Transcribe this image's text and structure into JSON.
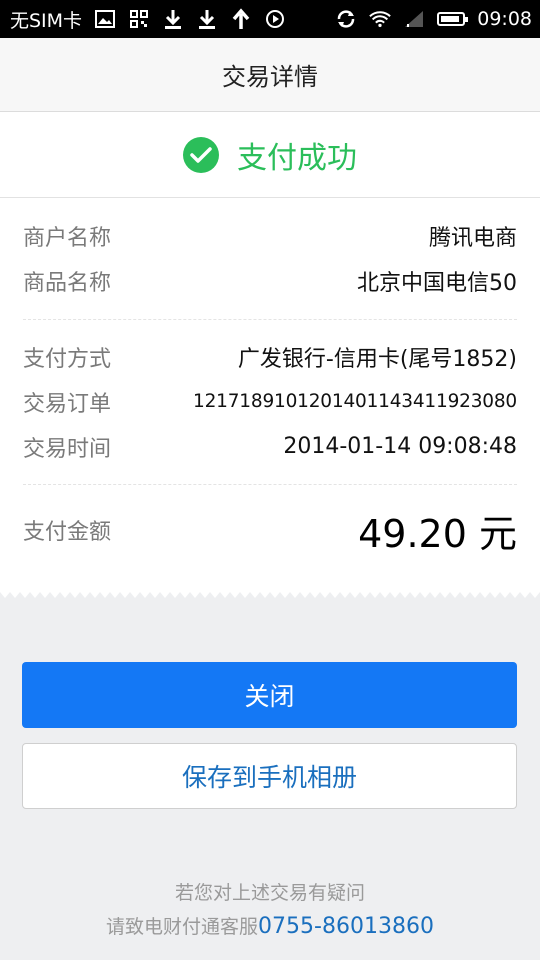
{
  "status_bar": {
    "carrier": "无SIM卡",
    "time": "09:08",
    "icons_left": [
      "image-icon",
      "grid-icon",
      "download-icon",
      "download-icon",
      "upload-icon",
      "play-icon"
    ],
    "icons_right": [
      "sync-icon",
      "wifi-icon",
      "signal-icon",
      "battery-icon"
    ]
  },
  "header": {
    "title": "交易详情"
  },
  "status": {
    "text": "支付成功",
    "color": "#2bbe5a"
  },
  "details": {
    "merchant": {
      "label": "商户名称",
      "value": "腾讯电商"
    },
    "product": {
      "label": "商品名称",
      "value": "北京中国电信50"
    },
    "method": {
      "label": "支付方式",
      "value": "广发银行-信用卡(尾号1852)"
    },
    "order": {
      "label": "交易订单",
      "value": "1217189101201401143411923080"
    },
    "time": {
      "label": "交易时间",
      "value": "2014-01-14 09:08:48"
    },
    "amount": {
      "label": "支付金额",
      "value": "49.20 元"
    }
  },
  "buttons": {
    "close": "关闭",
    "save": "保存到手机相册"
  },
  "footer": {
    "line1": "若您对上述交易有疑问",
    "line2_prefix": "请致电财付通客服",
    "phone": "0755-86013860"
  },
  "colors": {
    "accent": "#1478f5",
    "link": "#1a6fbe",
    "success": "#2bbe5a"
  }
}
